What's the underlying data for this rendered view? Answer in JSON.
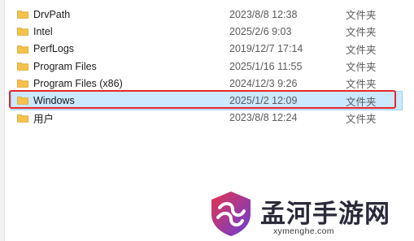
{
  "files": [
    {
      "name": "DrvPath",
      "date": "2023/8/8 12:38",
      "type": "文件夹"
    },
    {
      "name": "Intel",
      "date": "2025/2/6 9:03",
      "type": "文件夹"
    },
    {
      "name": "PerfLogs",
      "date": "2019/12/7 17:14",
      "type": "文件夹"
    },
    {
      "name": "Program Files",
      "date": "2025/1/16 11:55",
      "type": "文件夹"
    },
    {
      "name": "Program Files (x86)",
      "date": "2024/12/3 9:26",
      "type": "文件夹"
    },
    {
      "name": "Windows",
      "date": "2025/1/2 12:09",
      "type": "文件夹"
    },
    {
      "name": "用户",
      "date": "2023/8/8 12:24",
      "type": "文件夹"
    }
  ],
  "selected_index": 5,
  "icons": {
    "folder": "folder-icon"
  },
  "colors": {
    "folder": "#f5c24b",
    "selection": "#cce8ff",
    "highlight_border": "#e8262d"
  },
  "watermark": {
    "title": "孟河手游网",
    "url": "xymenghe.com"
  }
}
